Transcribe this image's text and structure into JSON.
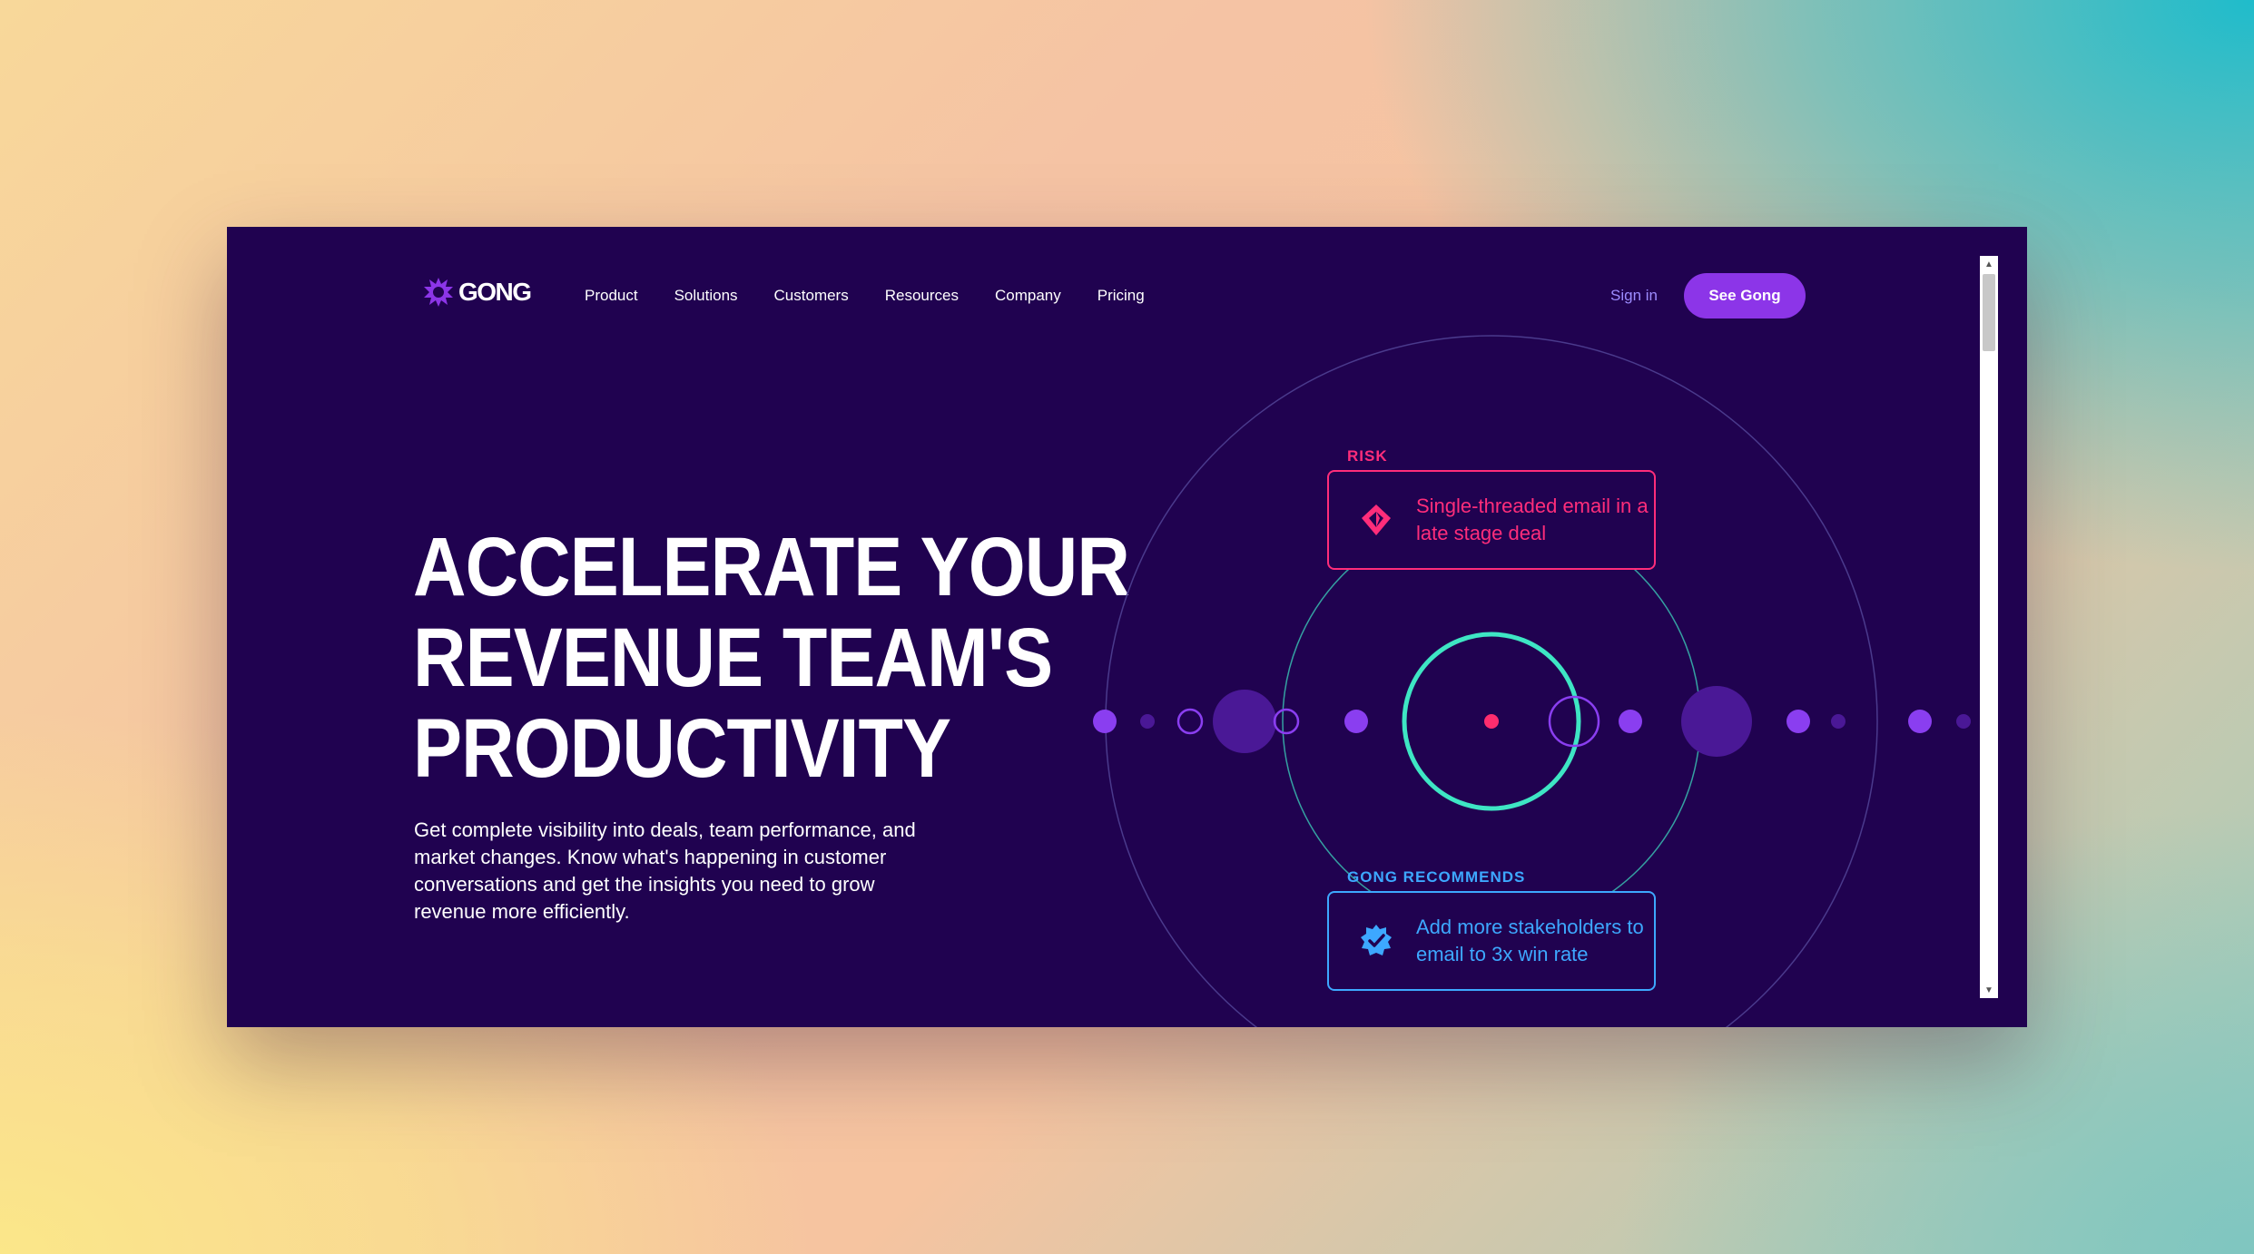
{
  "brand": {
    "name": "GONG",
    "color": "#8c35e8"
  },
  "nav": {
    "items": [
      {
        "label": "Product"
      },
      {
        "label": "Solutions"
      },
      {
        "label": "Customers"
      },
      {
        "label": "Resources"
      },
      {
        "label": "Company"
      },
      {
        "label": "Pricing"
      }
    ],
    "signin_label": "Sign in",
    "cta_label": "See Gong"
  },
  "hero": {
    "headline_lines": [
      "ACCELERATE YOUR",
      "REVENUE TEAM'S",
      "PRODUCTIVITY"
    ],
    "subtext": "Get complete visibility into deals, team performance, and market changes. Know what's happening in customer conversations and get the insights you need to grow revenue more efficiently."
  },
  "risk": {
    "label": "RISK",
    "text": "Single-threaded email in a late stage deal",
    "icon": "risk-diamond-icon",
    "color": "#ff2d7a"
  },
  "recommendation": {
    "label": "GONG RECOMMENDS",
    "text": "Add more stakeholders to email to 3x win rate",
    "icon": "verified-badge-icon",
    "color": "#3da8ff"
  },
  "colors": {
    "page_bg": "#200250",
    "accent_purple": "#8c35e8",
    "ring_teal": "#3ee6c4",
    "dot_red": "#ff2d6e"
  }
}
